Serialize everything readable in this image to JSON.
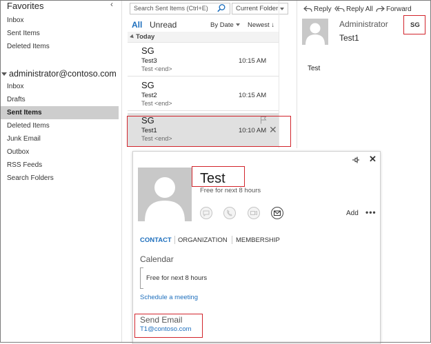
{
  "favorites": {
    "header": "Favorites",
    "items": [
      "Inbox",
      "Sent Items",
      "Deleted Items"
    ]
  },
  "account": {
    "header": "administrator@contoso.com",
    "items": [
      "Inbox",
      "Drafts",
      "Sent Items",
      "Deleted Items",
      "Junk Email",
      "Outbox",
      "RSS Feeds",
      "Search Folders"
    ],
    "selected_index": 2
  },
  "list": {
    "search_placeholder": "Search Sent Items (Ctrl+E)",
    "scope": "Current Folder",
    "tab_all": "All",
    "tab_unread": "Unread",
    "sort_by": "By Date",
    "sort_order": "Newest ↓",
    "group": "Today",
    "messages": [
      {
        "from": "SG",
        "subject": "Test3",
        "time": "10:15 AM",
        "preview": "Test <end>"
      },
      {
        "from": "SG",
        "subject": "Test2",
        "time": "10:15 AM",
        "preview": "Test <end>"
      },
      {
        "from": "SG",
        "subject": "Test1",
        "time": "10:10 AM",
        "preview": "Test <end>"
      }
    ]
  },
  "reading": {
    "reply": "Reply",
    "reply_all": "Reply All",
    "forward": "Forward",
    "sender": "Administrator",
    "subject": "Test1",
    "initials": "SG",
    "body": "Test"
  },
  "card": {
    "name": "Test",
    "status": "Free for next 8 hours",
    "add_label": "Add",
    "more_label": "•••",
    "tabs": [
      "CONTACT",
      "ORGANIZATION",
      "MEMBERSHIP"
    ],
    "calendar_title": "Calendar",
    "calendar_text": "Free for next 8 hours",
    "schedule_link": "Schedule a meeting",
    "send_email_title": "Send Email",
    "email": "T1@contoso.com"
  },
  "colors": {
    "accent": "#1e6fbd",
    "highlight": "#d1232a",
    "selection": "#cdcdcd"
  }
}
